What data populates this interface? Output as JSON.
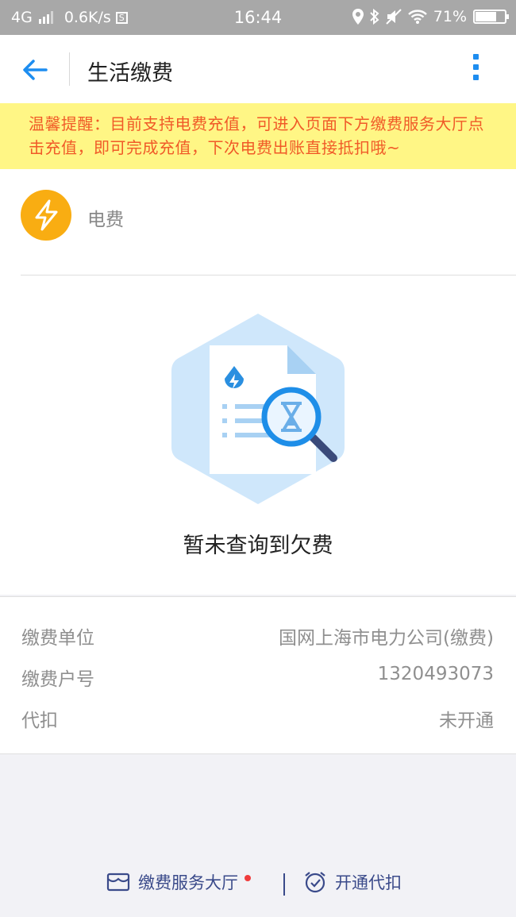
{
  "status_bar": {
    "network": "4G",
    "speed": "0.6K/s",
    "time": "16:44",
    "battery": "71%",
    "battery_level": 0.71
  },
  "nav": {
    "title": "生活缴费"
  },
  "notice": {
    "text": "温馨提醒：目前支持电费充值，可进入页面下方缴费服务大厅点击充值，即可完成充值，下次电费出账直接抵扣哦~"
  },
  "fee": {
    "label": "电费",
    "icon": "lightning-icon",
    "icon_color": "#f9ad12"
  },
  "empty_state": {
    "message": "暂未查询到欠费"
  },
  "info_rows": [
    {
      "key": "缴费单位",
      "value": "国网上海市电力公司(缴费)"
    },
    {
      "key": "缴费户号",
      "value": "1320493073"
    },
    {
      "key": "代扣",
      "value": "未开通"
    }
  ],
  "bottom": {
    "service_hall": "缴费服务大厅",
    "auto_pay": "开通代扣"
  },
  "colors": {
    "accent": "#1d8df0",
    "notice_bg": "#fff685",
    "notice_text": "#f05a28",
    "badge": "#f03c3c"
  }
}
